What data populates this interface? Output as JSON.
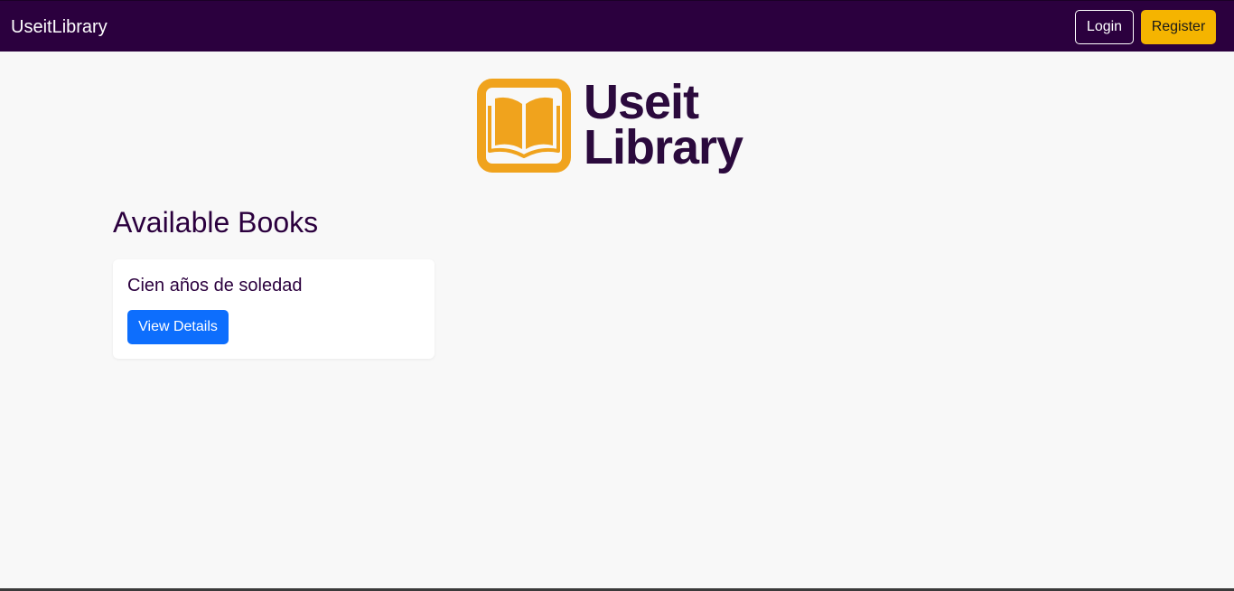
{
  "navbar": {
    "brand": "UseitLibrary",
    "login_label": "Login",
    "register_label": "Register",
    "background_color": "#2b003e",
    "register_color": "#f5b400"
  },
  "logo": {
    "line1": "Useit",
    "line2": "Library",
    "icon": "open-book-icon",
    "icon_color": "#f0a31d",
    "text_color": "#2b0a3d"
  },
  "main": {
    "section_title": "Available Books",
    "books": [
      {
        "title": "Cien años de soledad",
        "button_label": "View Details",
        "button_color": "#0d6efd"
      }
    ]
  }
}
